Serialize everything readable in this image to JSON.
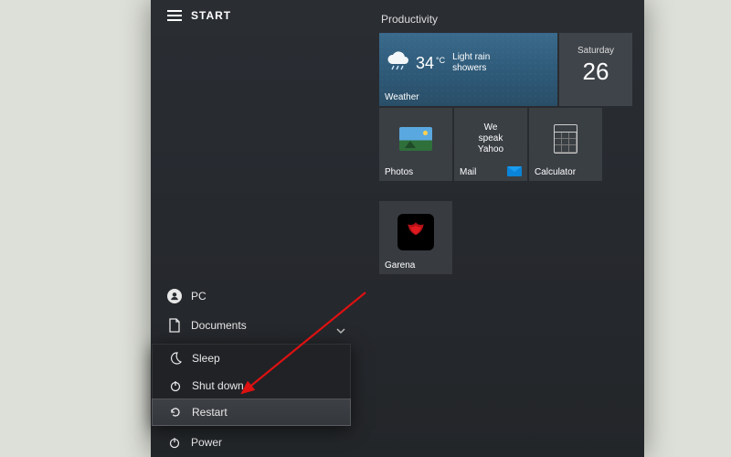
{
  "header": {
    "title": "START"
  },
  "rail": {
    "user": "PC",
    "documents": "Documents",
    "power": "Power"
  },
  "power_menu": {
    "sleep": "Sleep",
    "shutdown": "Shut down",
    "restart": "Restart"
  },
  "tiles": {
    "section": "Productivity",
    "weather": {
      "label": "Weather",
      "temp_value": "34",
      "temp_unit": "°C",
      "condition_line1": "Light rain",
      "condition_line2": "showers"
    },
    "date": {
      "day": "Saturday",
      "num": "26"
    },
    "photos": {
      "label": "Photos"
    },
    "mail": {
      "label": "Mail",
      "headline_line1": "We speak",
      "headline_line2": "Yahoo"
    },
    "calculator": {
      "label": "Calculator"
    },
    "garena": {
      "label": "Garena"
    }
  }
}
